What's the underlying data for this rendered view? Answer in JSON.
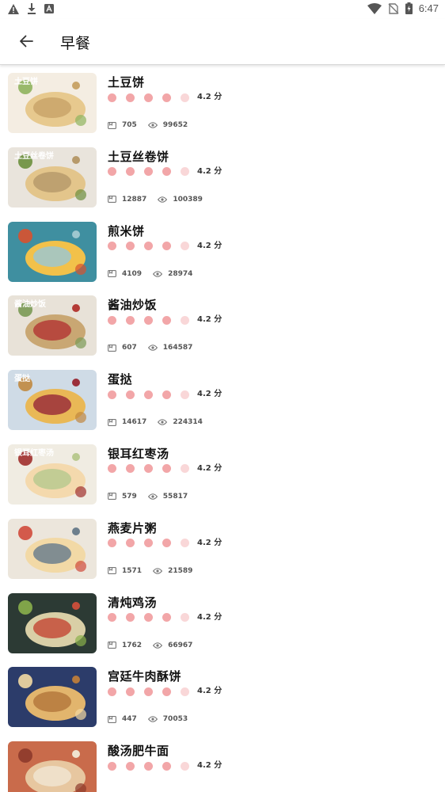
{
  "status_bar": {
    "time": "6:47",
    "left_icons": [
      "warning-icon",
      "download-icon",
      "app-notification-icon"
    ],
    "right_icons": [
      "wifi-icon",
      "no-sim-icon",
      "battery-icon"
    ]
  },
  "header": {
    "title": "早餐",
    "back_icon": "arrow-back-icon"
  },
  "theme": {
    "accent": "#f2a6a8",
    "dot_filled": "#f2a6a8",
    "dot_empty": "#f9d7d8"
  },
  "recipes": [
    {
      "name": "土豆饼",
      "rating_text": "4.2 分",
      "rating": 4.2,
      "collects": "705",
      "views": "99652",
      "thumb_text": "土豆饼"
    },
    {
      "name": "土豆丝卷饼",
      "rating_text": "4.2 分",
      "rating": 4.2,
      "collects": "12887",
      "views": "100389",
      "thumb_text": "土豆丝卷饼"
    },
    {
      "name": "煎米饼",
      "rating_text": "4.2 分",
      "rating": 4.2,
      "collects": "4109",
      "views": "28974",
      "thumb_text": ""
    },
    {
      "name": "酱油炒饭",
      "rating_text": "4.2 分",
      "rating": 4.2,
      "collects": "607",
      "views": "164587",
      "thumb_text": "酱油炒饭"
    },
    {
      "name": "蛋挞",
      "rating_text": "4.2 分",
      "rating": 4.2,
      "collects": "14617",
      "views": "224314",
      "thumb_text": "蛋挞"
    },
    {
      "name": "银耳红枣汤",
      "rating_text": "4.2 分",
      "rating": 4.2,
      "collects": "579",
      "views": "55817",
      "thumb_text": "银耳红枣汤"
    },
    {
      "name": "燕麦片粥",
      "rating_text": "4.2 分",
      "rating": 4.2,
      "collects": "1571",
      "views": "21589",
      "thumb_text": ""
    },
    {
      "name": "清炖鸡汤",
      "rating_text": "4.2 分",
      "rating": 4.2,
      "collects": "1762",
      "views": "66967",
      "thumb_text": ""
    },
    {
      "name": "宫廷牛肉酥饼",
      "rating_text": "4.2 分",
      "rating": 4.2,
      "collects": "447",
      "views": "70053",
      "thumb_text": ""
    },
    {
      "name": "酸汤肥牛面",
      "rating_text": "4.2 分",
      "rating": 4.2,
      "collects": "",
      "views": "",
      "thumb_text": ""
    }
  ]
}
